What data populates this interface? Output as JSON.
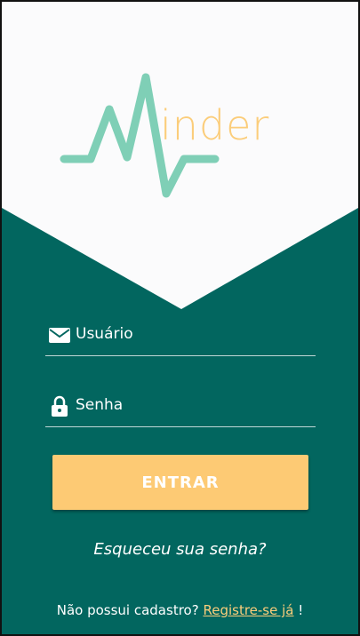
{
  "logo": {
    "text": "inder"
  },
  "login": {
    "username_placeholder": "Usuário",
    "password_placeholder": "Senha",
    "submit_label": "ENTRAR",
    "forgot_label": "Esqueceu sua senha?",
    "register_prefix": "Não possui cadastro?",
    "register_link": "Registre-se já",
    "register_suffix": "!"
  },
  "colors": {
    "background": "#02665f",
    "logo_line": "#7fcfb6",
    "accent": "#fdca74"
  }
}
